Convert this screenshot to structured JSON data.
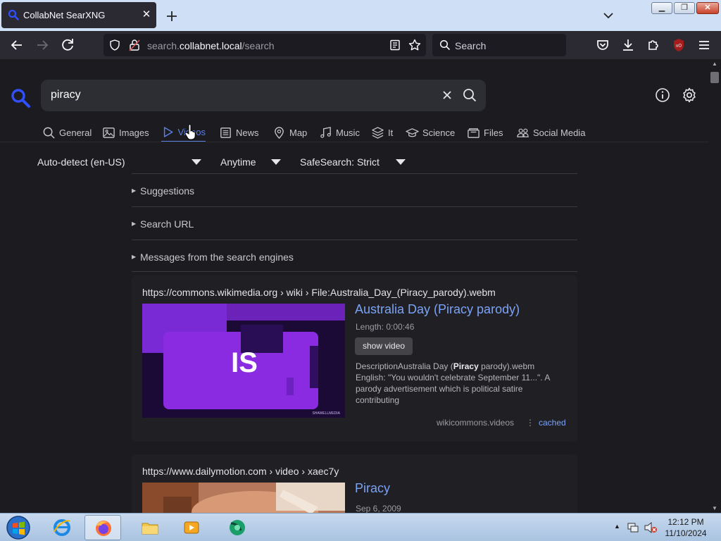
{
  "browser": {
    "tab_title": "CollabNet SearXNG",
    "url_prefix": "search.",
    "url_domain": "collabnet.local",
    "url_path": "/search",
    "search_placeholder": "Search"
  },
  "search": {
    "query": "piracy"
  },
  "categories": [
    {
      "label": "General",
      "icon": "search-icon",
      "active": false
    },
    {
      "label": "Images",
      "icon": "image-icon",
      "active": false
    },
    {
      "label": "Videos",
      "icon": "play-icon",
      "active": true
    },
    {
      "label": "News",
      "icon": "newspaper-icon",
      "active": false
    },
    {
      "label": "Map",
      "icon": "map-pin-icon",
      "active": false
    },
    {
      "label": "Music",
      "icon": "music-note-icon",
      "active": false
    },
    {
      "label": "It",
      "icon": "layers-icon",
      "active": false
    },
    {
      "label": "Science",
      "icon": "graduation-cap-icon",
      "active": false
    },
    {
      "label": "Files",
      "icon": "files-icon",
      "active": false
    },
    {
      "label": "Social Media",
      "icon": "people-icon",
      "active": false
    }
  ],
  "filters": {
    "language": "Auto-detect (en-US)",
    "time_range": "Anytime",
    "safesearch": "SafeSearch: Strict"
  },
  "expanders": [
    {
      "label": "Suggestions"
    },
    {
      "label": "Search URL"
    },
    {
      "label": "Messages from the search engines"
    }
  ],
  "results": [
    {
      "url": "https://commons.wikimedia.org",
      "path": "› wiki › File:Australia_Day_(Piracy_parody).webm",
      "title": "Australia Day (Piracy parody)",
      "length": "Length: 0:00:46",
      "show_video": "show video",
      "thumb_text": "IS",
      "thumb_watermark": "SHAWELLMEDIA",
      "desc_pre": "DescriptionAustralia Day (",
      "desc_bold": "Piracy",
      "desc_post": " parody).webm English: \"You wouldn't celebrate September 11...\". A parody advertisement which is political satire contributing",
      "engine": "wikicommons.videos",
      "cached": "cached"
    },
    {
      "url": "https://www.dailymotion.com",
      "path": "› video › xaec7y",
      "title": "Piracy",
      "date": "Sep 6, 2009"
    }
  ],
  "taskbar": {
    "time": "12:12 PM",
    "date": "11/10/2024"
  }
}
